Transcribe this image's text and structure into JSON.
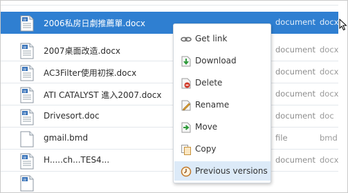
{
  "files": [
    {
      "name": "2006私房日劇推薦單.docx",
      "type": "document",
      "ext": "docx",
      "selected": true,
      "icon": "word-doc-icon"
    },
    {
      "name": "2007桌面改造.docx",
      "type": "document",
      "ext": "docx",
      "selected": false,
      "icon": "word-doc-icon"
    },
    {
      "name": "AC3Filter使用初探.docx",
      "type": "document",
      "ext": "docx",
      "selected": false,
      "icon": "word-doc-icon"
    },
    {
      "name": "ATI CATALYST 進入2007.docx",
      "type": "document",
      "ext": "docx",
      "selected": false,
      "icon": "word-doc-icon"
    },
    {
      "name": "Drivesort.doc",
      "type": "document",
      "ext": "doc",
      "selected": false,
      "icon": "word-doc-icon"
    },
    {
      "name": "gmail.bmd",
      "type": "file",
      "ext": "bmd",
      "selected": false,
      "icon": "generic-file-icon"
    },
    {
      "name": "H.....ch...TES4...",
      "type": "document",
      "ext": "docx",
      "selected": false,
      "icon": "word-doc-icon"
    }
  ],
  "context_menu": {
    "items": [
      {
        "label": "Get link",
        "icon": "link-icon"
      },
      {
        "label": "Download",
        "icon": "download-icon"
      },
      {
        "label": "Delete",
        "icon": "delete-icon"
      },
      {
        "label": "Rename",
        "icon": "rename-icon"
      },
      {
        "label": "Move",
        "icon": "move-icon"
      },
      {
        "label": "Copy",
        "icon": "copy-icon"
      },
      {
        "label": "Previous versions",
        "icon": "clock-icon",
        "hovered": true
      }
    ]
  },
  "colors": {
    "selection": "#2f7fd1",
    "menu_hover": "#dceaf8"
  }
}
